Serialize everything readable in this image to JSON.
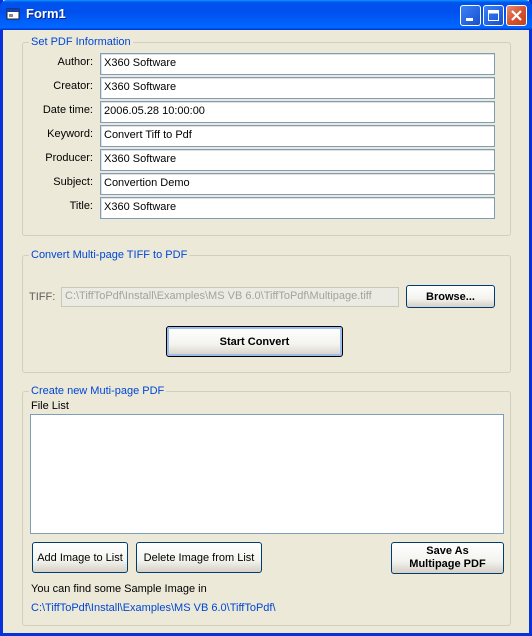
{
  "window": {
    "title": "Form1"
  },
  "pdf_info": {
    "group_title": "Set PDF Information",
    "fields": [
      {
        "label": "Author:",
        "value": "X360 Software"
      },
      {
        "label": "Creator:",
        "value": "X360 Software"
      },
      {
        "label": "Date time:",
        "value": "2006.05.28 10:00:00"
      },
      {
        "label": "Keyword:",
        "value": "Convert Tiff to Pdf"
      },
      {
        "label": "Producer:",
        "value": "X360 Software"
      },
      {
        "label": "Subject:",
        "value": "Convertion Demo"
      },
      {
        "label": "Title:",
        "value": "X360 Software"
      }
    ]
  },
  "convert_tiff": {
    "group_title": "Convert Multi-page TIFF to PDF",
    "tiff_label": "TIFF:",
    "tiff_path": "C:\\TiffToPdf\\Install\\Examples\\MS VB 6.0\\TiffToPdf\\Multipage.tiff",
    "browse_label": "Browse...",
    "start_label": "Start Convert"
  },
  "create_pdf": {
    "group_title": "Create new Muti-page PDF",
    "file_list_label": "File List",
    "add_label": "Add Image to List",
    "delete_label": "Delete Image from List",
    "save_line1": "Save As",
    "save_line2": "Multipage PDF",
    "hint_text": "You can find some Sample Image in",
    "hint_path": "C:\\TiffToPdf\\Install\\Examples\\MS VB 6.0\\TiffToPdf\\"
  }
}
